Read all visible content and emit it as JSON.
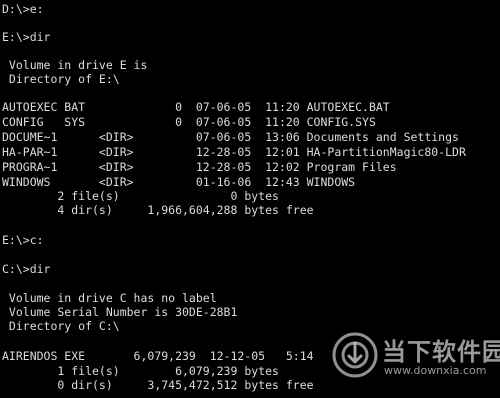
{
  "console": {
    "lines": [
      "D:\\>e:",
      "",
      "E:\\>dir",
      "",
      " Volume in drive E is",
      " Directory of E:\\",
      "",
      "AUTOEXEC BAT             0  07-06-05  11:20 AUTOEXEC.BAT",
      "CONFIG   SYS             0  07-06-05  11:20 CONFIG.SYS",
      "DOCUME~1      <DIR>         07-06-05  13:06 Documents and Settings",
      "HA-PAR~1      <DIR>         12-28-05  12:01 HA-PartitionMagic80-LDR",
      "PROGRA~1      <DIR>         12-28-05  12:02 Program Files",
      "WINDOWS       <DIR>         01-16-06  12:43 WINDOWS",
      "        2 file(s)                0 bytes",
      "        4 dir(s)     1,966,604,288 bytes free",
      "",
      "E:\\>c:",
      "",
      "C:\\>dir",
      "",
      " Volume in drive C has no label",
      " Volume Serial Number is 30DE-28B1",
      " Directory of C:\\",
      "",
      "AIRENDOS EXE       6,079,239  12-12-05   5:14",
      "        1 file(s)        6,079,239 bytes",
      "        0 dir(s)     3,745,472,512 bytes free"
    ]
  },
  "watermark": {
    "title": "当下软件园",
    "url": "www.downxia.com",
    "logo_icon": "downxia-logo-icon"
  },
  "colors": {
    "background": "#000000",
    "text": "#dcdcdc"
  }
}
